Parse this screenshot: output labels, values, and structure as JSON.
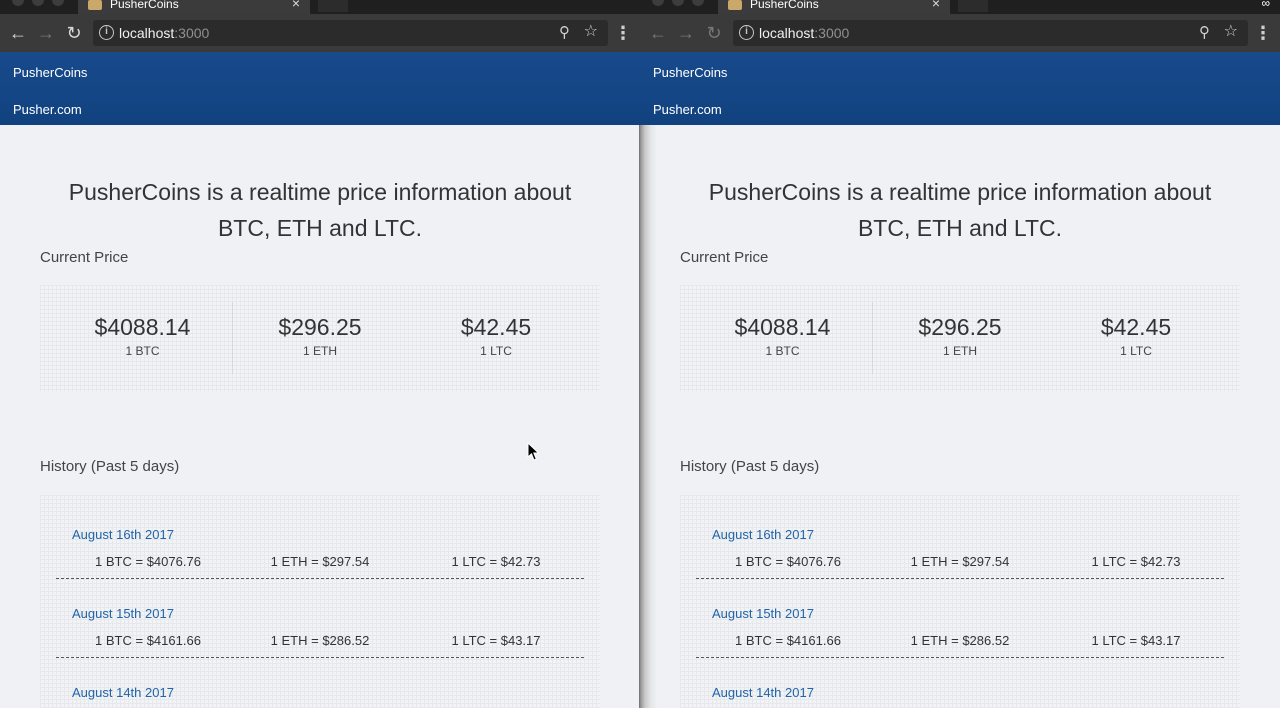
{
  "browser": {
    "tab_title": "PusherCoins",
    "tab_close": "×",
    "url_host": "localhost",
    "url_port": ":3000",
    "profile_label": "∞",
    "back_icon": "arrow-left-icon",
    "forward_icon": "arrow-right-icon",
    "reload_icon": "reload-icon",
    "info_icon": "info-icon",
    "zoom_icon": "zoom-icon",
    "bookmark_icon": "star-icon",
    "menu_icon": "kebab-menu-icon"
  },
  "app": {
    "brand": "PusherCoins",
    "nav_link": "Pusher.com",
    "hero": "PusherCoins is a realtime price information about BTC, ETH and LTC.",
    "current_price_title": "Current Price",
    "history_title": "History (Past 5 days)",
    "nav_color": "#11427f",
    "date_color": "#2264a8"
  },
  "prices": [
    {
      "value": "$4088.14",
      "unit": "1 BTC"
    },
    {
      "value": "$296.25",
      "unit": "1 ETH"
    },
    {
      "value": "$42.45",
      "unit": "1 LTC"
    }
  ],
  "history": [
    {
      "date": "August 16th 2017",
      "btc": "1 BTC = $4076.76",
      "eth": "1 ETH = $297.54",
      "ltc": "1 LTC = $42.73"
    },
    {
      "date": "August 15th 2017",
      "btc": "1 BTC = $4161.66",
      "eth": "1 ETH = $286.52",
      "ltc": "1 LTC = $43.17"
    },
    {
      "date": "August 14th 2017",
      "btc": "",
      "eth": "",
      "ltc": ""
    }
  ]
}
